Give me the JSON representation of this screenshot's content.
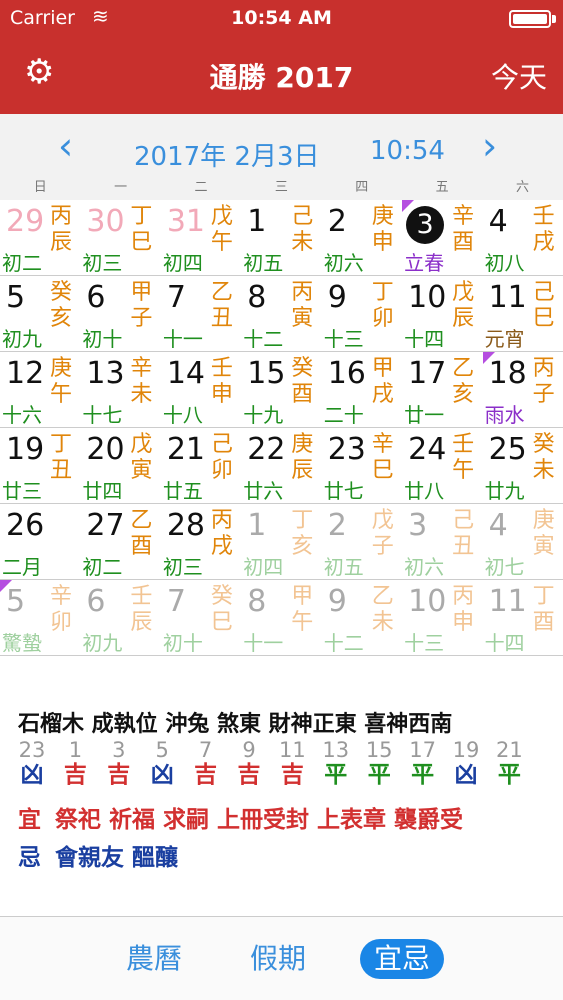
{
  "status": {
    "carrier": "Carrier",
    "time": "10:54 AM"
  },
  "nav": {
    "title": "通勝 2017",
    "today": "今天"
  },
  "datebar": {
    "date": "2017年 2月3日",
    "time": "10:54"
  },
  "weekdays": [
    "日",
    "一",
    "二",
    "三",
    "四",
    "五",
    "六"
  ],
  "weeks": [
    [
      {
        "day": "29",
        "gz": "丙辰",
        "lunar": "初二",
        "style": "pink"
      },
      {
        "day": "30",
        "gz": "丁巳",
        "lunar": "初三",
        "style": "pink"
      },
      {
        "day": "31",
        "gz": "戊午",
        "lunar": "初四",
        "style": "pink"
      },
      {
        "day": "1",
        "gz": "己未",
        "lunar": "初五"
      },
      {
        "day": "2",
        "gz": "庚申",
        "lunar": "初六"
      },
      {
        "day": "3",
        "gz": "辛酉",
        "lunar": "立春",
        "term": true,
        "selected": true,
        "flag": true
      },
      {
        "day": "4",
        "gz": "壬戌",
        "lunar": "初八"
      }
    ],
    [
      {
        "day": "5",
        "gz": "癸亥",
        "lunar": "初九"
      },
      {
        "day": "6",
        "gz": "甲子",
        "lunar": "初十"
      },
      {
        "day": "7",
        "gz": "乙丑",
        "lunar": "十一"
      },
      {
        "day": "8",
        "gz": "丙寅",
        "lunar": "十二"
      },
      {
        "day": "9",
        "gz": "丁卯",
        "lunar": "十三"
      },
      {
        "day": "10",
        "gz": "戊辰",
        "lunar": "十四"
      },
      {
        "day": "11",
        "gz": "己巳",
        "lunar": "元宵",
        "festival": true
      }
    ],
    [
      {
        "day": "12",
        "gz": "庚午",
        "lunar": "十六"
      },
      {
        "day": "13",
        "gz": "辛未",
        "lunar": "十七"
      },
      {
        "day": "14",
        "gz": "壬申",
        "lunar": "十八"
      },
      {
        "day": "15",
        "gz": "癸酉",
        "lunar": "十九"
      },
      {
        "day": "16",
        "gz": "甲戌",
        "lunar": "二十"
      },
      {
        "day": "17",
        "gz": "乙亥",
        "lunar": "廿一"
      },
      {
        "day": "18",
        "gz": "丙子",
        "lunar": "雨水",
        "term": true,
        "flag": true
      }
    ],
    [
      {
        "day": "19",
        "gz": "丁丑",
        "lunar": "廿三"
      },
      {
        "day": "20",
        "gz": "戊寅",
        "lunar": "廿四"
      },
      {
        "day": "21",
        "gz": "己卯",
        "lunar": "廿五"
      },
      {
        "day": "22",
        "gz": "庚辰",
        "lunar": "廿六"
      },
      {
        "day": "23",
        "gz": "辛巳",
        "lunar": "廿七"
      },
      {
        "day": "24",
        "gz": "壬午",
        "lunar": "廿八"
      },
      {
        "day": "25",
        "gz": "癸未",
        "lunar": "廿九"
      }
    ],
    [
      {
        "day": "26",
        "gz": "",
        "lunar": "二月"
      },
      {
        "day": "27",
        "gz": "乙酉",
        "lunar": "初二"
      },
      {
        "day": "28",
        "gz": "丙戌",
        "lunar": "初三"
      },
      {
        "day": "1",
        "gz": "丁亥",
        "lunar": "初四",
        "style": "dim"
      },
      {
        "day": "2",
        "gz": "戊子",
        "lunar": "初五",
        "style": "dim"
      },
      {
        "day": "3",
        "gz": "己丑",
        "lunar": "初六",
        "style": "dim"
      },
      {
        "day": "4",
        "gz": "庚寅",
        "lunar": "初七",
        "style": "dim"
      }
    ],
    [
      {
        "day": "5",
        "gz": "辛卯",
        "lunar": "驚蟄",
        "style": "dim",
        "term": true,
        "flag": true
      },
      {
        "day": "6",
        "gz": "壬辰",
        "lunar": "初九",
        "style": "dim"
      },
      {
        "day": "7",
        "gz": "癸巳",
        "lunar": "初十",
        "style": "dim"
      },
      {
        "day": "8",
        "gz": "甲午",
        "lunar": "十一",
        "style": "dim"
      },
      {
        "day": "9",
        "gz": "乙未",
        "lunar": "十二",
        "style": "dim"
      },
      {
        "day": "10",
        "gz": "丙申",
        "lunar": "十三",
        "style": "dim"
      },
      {
        "day": "11",
        "gz": "丁酉",
        "lunar": "十四",
        "style": "dim"
      }
    ]
  ],
  "info": {
    "line1": "石榴木 成執位  沖兔 煞東  財神正東 喜神西南"
  },
  "hours": [
    {
      "n": "23",
      "v": "凶",
      "color": "#1a3fa0"
    },
    {
      "n": "1",
      "v": "吉",
      "color": "#d23030"
    },
    {
      "n": "3",
      "v": "吉",
      "color": "#d23030"
    },
    {
      "n": "5",
      "v": "凶",
      "color": "#1a3fa0"
    },
    {
      "n": "7",
      "v": "吉",
      "color": "#d23030"
    },
    {
      "n": "9",
      "v": "吉",
      "color": "#d23030"
    },
    {
      "n": "11",
      "v": "吉",
      "color": "#d23030"
    },
    {
      "n": "13",
      "v": "平",
      "color": "#1f8f1f"
    },
    {
      "n": "15",
      "v": "平",
      "color": "#1f8f1f"
    },
    {
      "n": "17",
      "v": "平",
      "color": "#1f8f1f"
    },
    {
      "n": "19",
      "v": "凶",
      "color": "#1a3fa0"
    },
    {
      "n": "21",
      "v": "平",
      "color": "#1f8f1f"
    }
  ],
  "yi": {
    "label": "宜",
    "text": "祭祀 祈福 求嗣 上冊受封 上表章 襲爵受"
  },
  "ji": {
    "label": "忌",
    "text": "會親友 醞釀"
  },
  "tabs": [
    "農曆",
    "假期",
    "宜忌"
  ]
}
